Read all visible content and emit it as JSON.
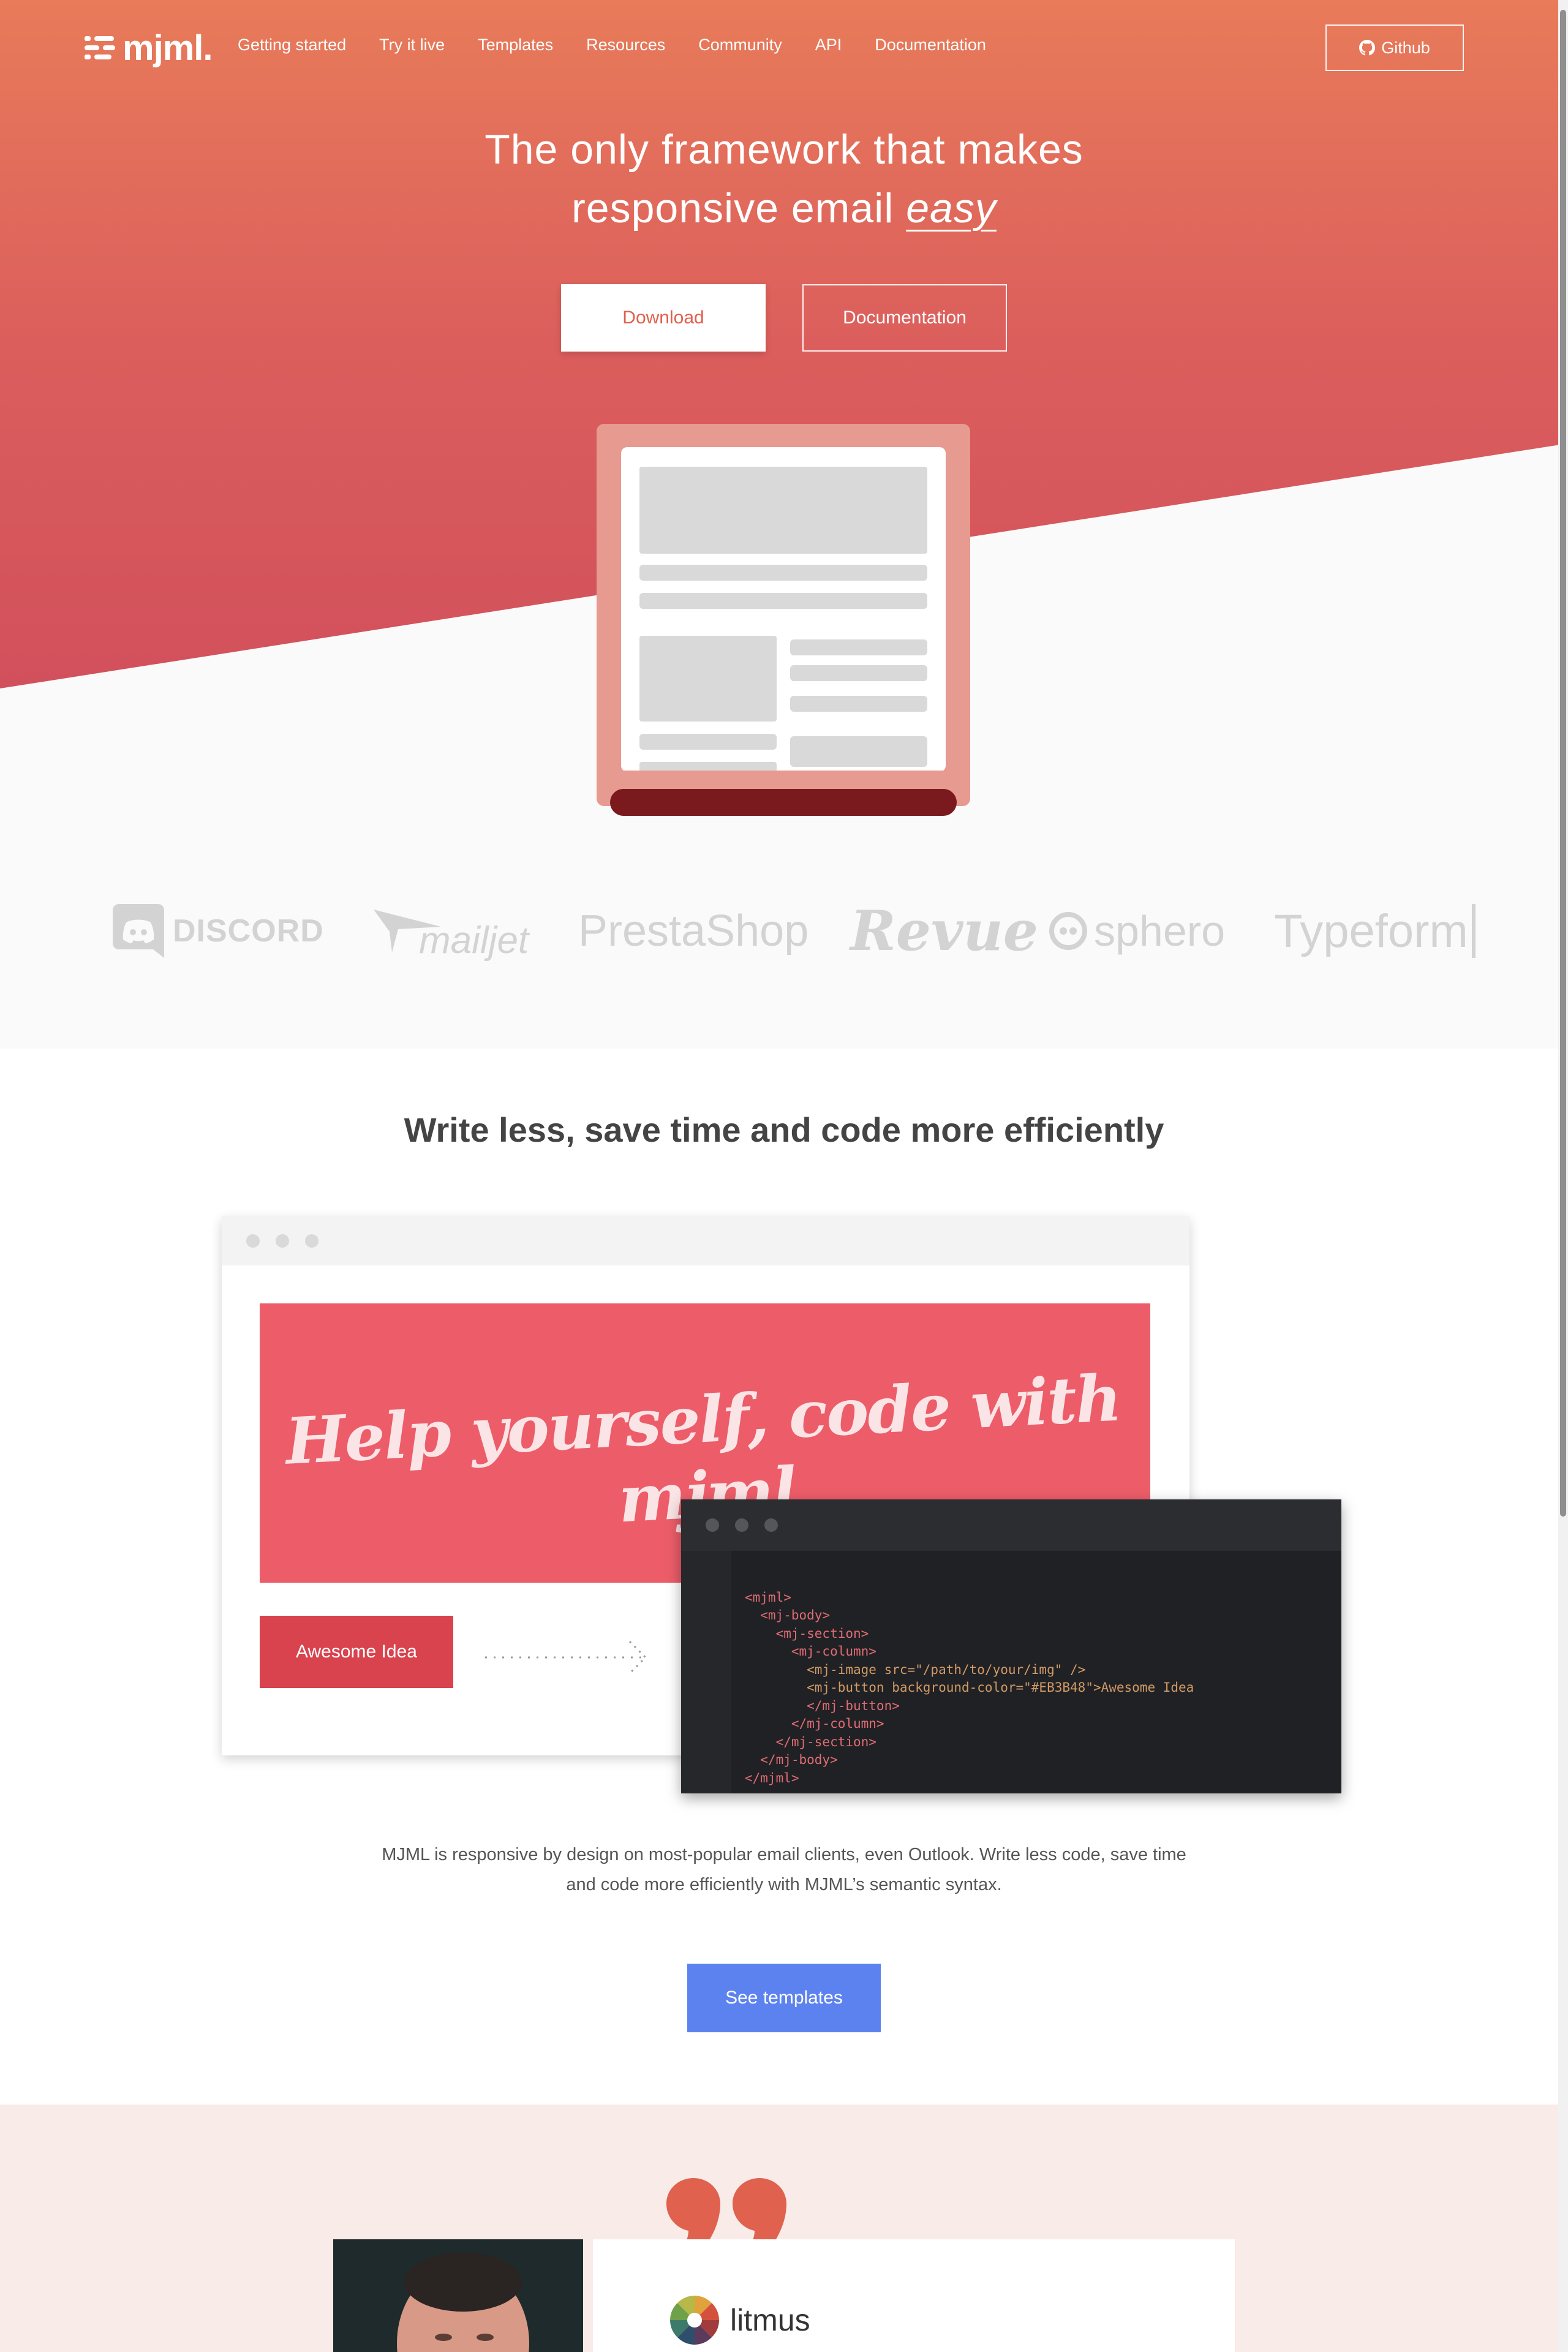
{
  "nav": {
    "logo_text": "mjml.",
    "links": [
      "Getting started",
      "Try it live",
      "Templates",
      "Resources",
      "Community",
      "API",
      "Documentation"
    ],
    "github_label": "Github"
  },
  "hero": {
    "title_line1": "The only framework that makes",
    "title_line2_prefix": "responsive email ",
    "title_line2_em": "easy",
    "download_label": "Download",
    "docs_label": "Documentation"
  },
  "logos": [
    "DISCORD",
    "mailjet",
    "PrestaShop",
    "Revue",
    "sphero",
    "Typeform"
  ],
  "section2": {
    "title": "Write less, save time and code more efficiently",
    "banner_text": "Help yourself, code with mjml",
    "awesome_button": "Awesome Idea",
    "code_lines": [
      "<mjml>",
      "  <mj-body>",
      "    <mj-section>",
      "      <mj-column>",
      "        <mj-image src=\"/path/to/your/img\" />",
      "        <mj-button background-color=\"#EB3B48\">Awesome Idea",
      "        </mj-button>",
      "      </mj-column>",
      "    </mj-section>",
      "  </mj-body>",
      "</mjml>"
    ],
    "description_line1": "MJML is responsive by design on most-popular email clients, even Outlook. Write less code, save time",
    "description_line2": "and code more efficiently with MJML’s semantic syntax.",
    "see_templates": "See templates"
  },
  "section3": {
    "brand": "litmus"
  },
  "colors": {
    "hero_top": "#e87b5a",
    "hero_bottom": "#d4525d",
    "accent_red": "#d9434d",
    "blue_button": "#5c82f0",
    "testimonial_bg": "#f8ebe8"
  }
}
